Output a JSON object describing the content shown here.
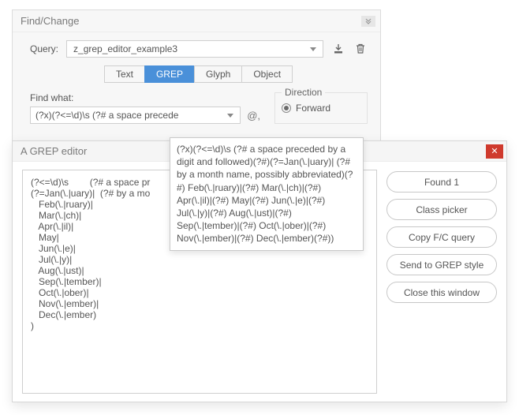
{
  "findchange": {
    "title": "Find/Change",
    "query_label": "Query:",
    "query_value": "z_grep_editor_example3",
    "tabs": [
      "Text",
      "GREP",
      "Glyph",
      "Object"
    ],
    "active_tab": "GREP",
    "find_what_label": "Find what:",
    "find_what_value": "(?x)(?<=\\d)\\s        (?# a space precede",
    "at_glyph": "@,",
    "direction_label": "Direction",
    "direction_option_forward": "Forward"
  },
  "tooltip": {
    "text": "(?x)(?<=\\d)\\s          (?# a space preceded by a digit and followed)(?#)(?=Jan(\\.|uary)|  (?# by a month name, possibly abbreviated)(?#)  Feb(\\.|ruary)|(?#)  Mar(\\.|ch)|(?#)  Apr(\\.|il)|(?#)  May|(?#)  Jun(\\.|e)|(?#)  Jul(\\.|y)|(?#)  Aug(\\.|ust)|(?#)  Sep(\\.|tember)|(?#)  Oct(\\.|ober)|(?#)  Nov(\\.|ember)|(?#)  Dec(\\.|ember)(?#))"
  },
  "grepeditor": {
    "title": "A GREP editor",
    "lines": [
      "(?<=\\d)\\s        (?# a space pr",
      "(?=Jan(\\.|uary)|  (?# by a mo",
      "   Feb(\\.|ruary)|",
      "   Mar(\\.|ch)|",
      "   Apr(\\.|il)|",
      "   May|",
      "   Jun(\\.|e)|",
      "   Jul(\\.|y)|",
      "   Aug(\\.|ust)|",
      "   Sep(\\.|tember)|",
      "   Oct(\\.|ober)|",
      "   Nov(\\.|ember)|",
      "   Dec(\\.|ember)",
      ")"
    ],
    "buttons": {
      "found": "Found 1",
      "classpicker": "Class picker",
      "copy": "Copy F/C query",
      "send": "Send to GREP style",
      "close": "Close this window"
    }
  }
}
